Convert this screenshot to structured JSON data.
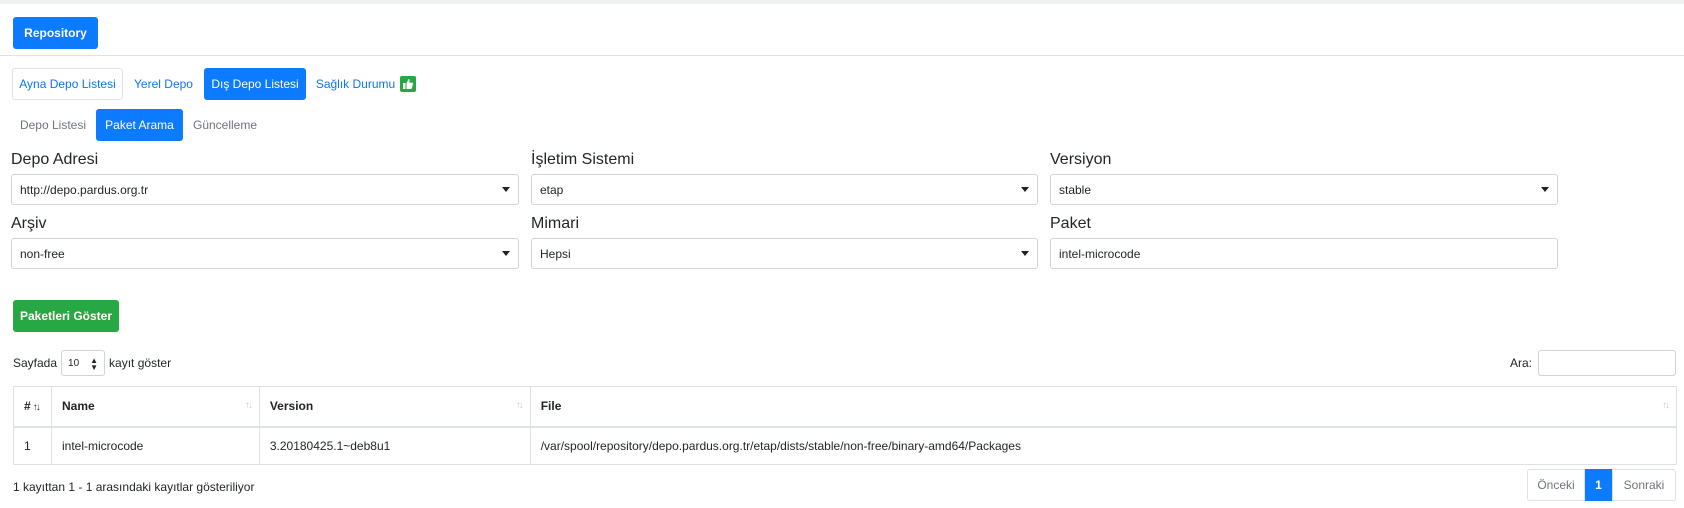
{
  "header": {
    "repository_button": "Repository"
  },
  "tabs": {
    "mirror_list": "Ayna Depo Listesi",
    "local_repo": "Yerel Depo",
    "external_list": "Dış Depo Listesi",
    "health": "Sağlık Durumu"
  },
  "subtabs": {
    "repo_list": "Depo Listesi",
    "package_search": "Paket Arama",
    "update": "Güncelleme"
  },
  "form": {
    "repo_address": {
      "label": "Depo Adresi",
      "value": "http://depo.pardus.org.tr"
    },
    "os": {
      "label": "İşletim Sistemi",
      "value": "etap"
    },
    "version": {
      "label": "Versiyon",
      "value": "stable"
    },
    "archive": {
      "label": "Arşiv",
      "value": "non-free"
    },
    "arch": {
      "label": "Mimari",
      "value": "Hepsi"
    },
    "package": {
      "label": "Paket",
      "value": "intel-microcode"
    },
    "show_button": "Paketleri Göster"
  },
  "table_controls": {
    "length_prefix": "Sayfada",
    "length_value": "10",
    "length_suffix": "kayıt göster",
    "search_label": "Ara:",
    "search_value": ""
  },
  "table": {
    "columns": [
      "#",
      "Name",
      "Version",
      "File"
    ],
    "rows": [
      [
        "1",
        "intel-microcode",
        "3.20180425.1~deb8u1",
        "/var/spool/repository/depo.pardus.org.tr/etap/dists/stable/non-free/binary-amd64/Packages"
      ]
    ]
  },
  "footer": {
    "info": "1 kayıttan 1 - 1 arasındaki kayıtlar gösteriliyor",
    "prev": "Önceki",
    "current_page": "1",
    "next": "Sonraki"
  },
  "colors": {
    "primary": "#0d7bff",
    "success": "#28a745",
    "link": "#0a78f0"
  }
}
